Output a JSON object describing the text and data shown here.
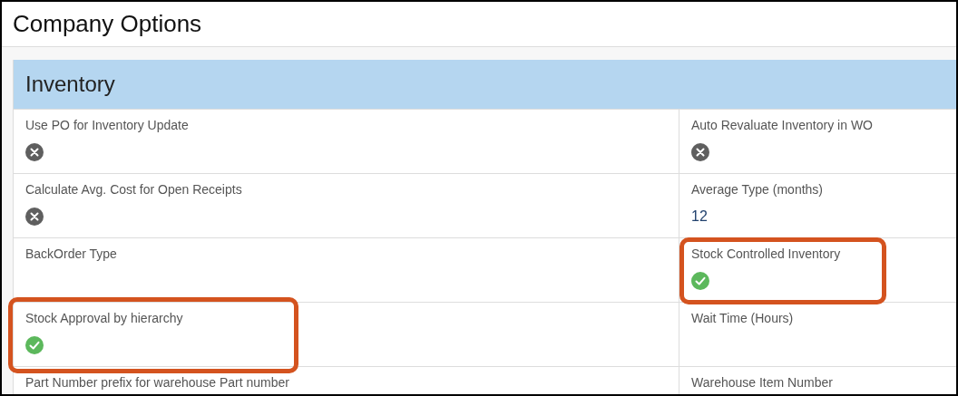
{
  "page": {
    "title": "Company Options"
  },
  "section": {
    "title": "Inventory",
    "rows": [
      {
        "left": {
          "label": "Use PO for Inventory Update",
          "kind": "toggle",
          "on": false,
          "highlighted": false
        },
        "right": {
          "label": "Auto Revaluate Inventory in WO",
          "kind": "toggle",
          "on": false,
          "highlighted": false
        }
      },
      {
        "left": {
          "label": "Calculate Avg. Cost for Open Receipts",
          "kind": "toggle",
          "on": false,
          "highlighted": false
        },
        "right": {
          "label": "Average Type (months)",
          "kind": "number",
          "value": "12",
          "highlighted": false
        }
      },
      {
        "left": {
          "label": "BackOrder Type",
          "kind": "blank",
          "highlighted": false
        },
        "right": {
          "label": "Stock Controlled Inventory",
          "kind": "toggle",
          "on": true,
          "highlighted": true
        }
      },
      {
        "left": {
          "label": "Stock Approval by hierarchy",
          "kind": "toggle",
          "on": true,
          "highlighted": true
        },
        "right": {
          "label": "Wait Time (Hours)",
          "kind": "blank",
          "highlighted": false
        }
      },
      {
        "left": {
          "label": "Part Number prefix for warehouse Part number",
          "kind": "blank",
          "highlighted": false
        },
        "right": {
          "label": "Warehouse Item Number",
          "kind": "blank",
          "highlighted": false
        }
      }
    ]
  }
}
